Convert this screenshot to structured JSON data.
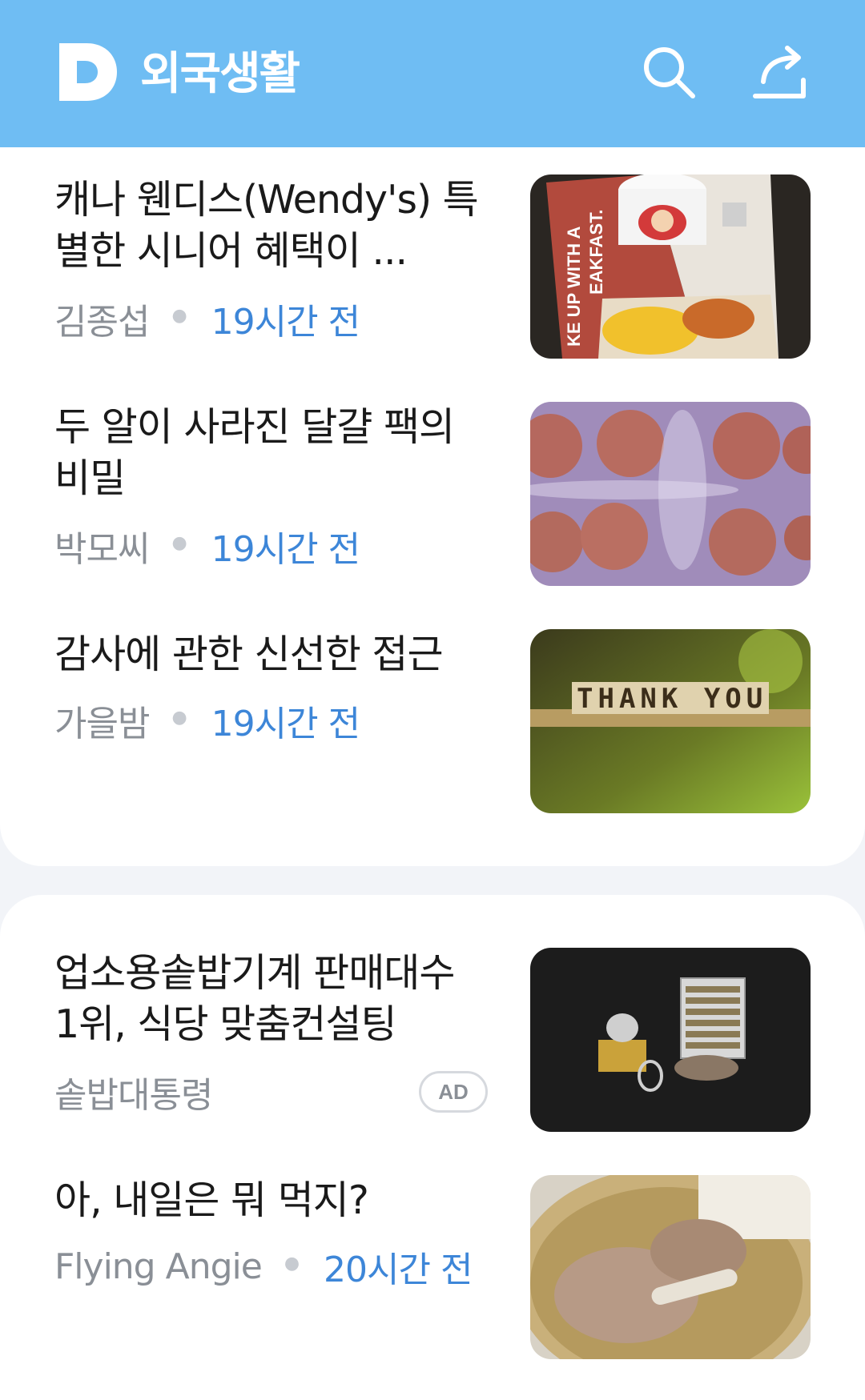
{
  "header": {
    "logo_letter": "D",
    "title": "외국생활",
    "search_icon": "search-icon",
    "share_icon": "share-icon",
    "background_color": "#6fbdf3"
  },
  "articles": [
    {
      "title": "캐나 웬디스(Wendy's) 특별한 시니어 혜택이 ...",
      "author": "김종섭",
      "time": "19시간 전",
      "thumbnail_text_1": "KE UP WITH A",
      "thumbnail_text_2": "EAKFAST."
    },
    {
      "title": "두 알이 사라진 달걀 팩의 비밀",
      "author": "박모씨",
      "time": "19시간 전"
    },
    {
      "title": "감사에 관한 신선한 접근",
      "author": "가을밤",
      "time": "19시간 전",
      "thumbnail_text": "THANK YOU"
    }
  ],
  "ad": {
    "title": "업소용솥밥기계 판매대수 1위, 식당 맞춤컨설팅",
    "advertiser": "솥밥대통령",
    "badge": "AD"
  },
  "more_articles": [
    {
      "title": "아, 내일은 뭐 먹지?",
      "author": "Flying Angie",
      "time": "20시간 전"
    }
  ],
  "colors": {
    "time_text": "#3d86d8",
    "author_text": "#8a8f96",
    "title_text": "#1a1a1a"
  }
}
